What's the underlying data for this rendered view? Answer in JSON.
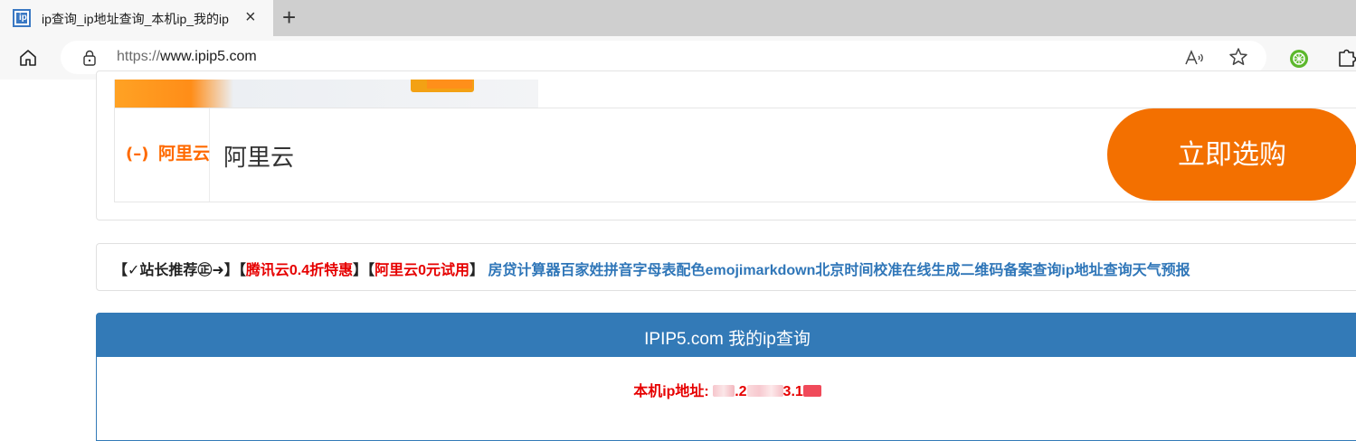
{
  "browser": {
    "tab": {
      "favicon": "ip",
      "title": "ip查询_ip地址查询_本机ip_我的ip",
      "close_icon": "×"
    },
    "new_tab_icon": "+",
    "address": {
      "scheme": "https://",
      "host": "www.ipip5.com"
    },
    "toolbar_icons": [
      "home-icon",
      "lock-icon",
      "read-aloud-icon",
      "favorite-star-icon",
      "extension-green-icon",
      "extensions-puzzle-icon"
    ]
  },
  "ad": {
    "logo_mark": "(–)",
    "logo_text": "阿里云",
    "brand": "阿里云",
    "button": "立即选购",
    "colors": {
      "brand_orange": "#ff6a00",
      "button": "#f37000"
    }
  },
  "recommend": {
    "prefix": "【✓站长推荐㊣➜】",
    "promos": [
      {
        "open": "【",
        "label": "腾讯云0.4折特惠",
        "close": "】"
      },
      {
        "open": "【",
        "label": "阿里云0元试用",
        "close": "】"
      }
    ],
    "links": [
      "房贷计算器",
      "百家姓",
      "拼音字母表",
      "配色",
      "emoji",
      "markdown",
      "北京时间校准",
      "在线生成二维码",
      "备案查询",
      "ip地址查询",
      "天气预报"
    ]
  },
  "panel": {
    "title": "IPIP5.com 我的ip查询",
    "ip_label": "本机ip地址:",
    "ip_visible_parts": [
      ".2",
      "3.1"
    ],
    "colors": {
      "header": "#337ab7",
      "ip_text": "#e60000"
    }
  }
}
